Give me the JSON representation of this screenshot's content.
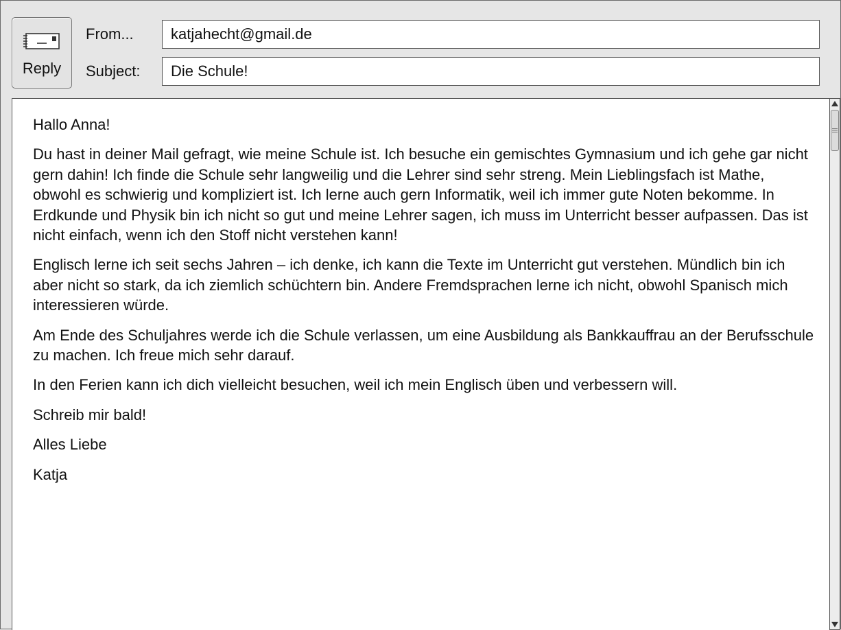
{
  "header": {
    "reply_label": "Reply",
    "from_label": "From...",
    "from_value": "katjahecht@gmail.de",
    "subject_label": "Subject:",
    "subject_value": "Die Schule!",
    "reply_icon": "envelope-icon"
  },
  "message": {
    "paragraphs": [
      "Hallo Anna!",
      "Du hast in deiner Mail gefragt, wie meine Schule ist. Ich besuche ein gemischtes Gymnasium und ich gehe gar nicht gern dahin! Ich finde die Schule sehr langweilig und die Lehrer sind sehr streng. Mein Lieblingsfach ist Mathe, obwohl es schwierig und kompliziert ist. Ich lerne auch gern Informatik, weil ich immer gute Noten bekomme. In Erdkunde und Physik bin ich nicht so gut und meine Lehrer sagen, ich muss im Unterricht besser aufpassen. Das ist nicht einfach, wenn ich den Stoff nicht verstehen kann!",
      "Englisch lerne ich seit sechs Jahren – ich denke, ich kann die Texte im Unterricht gut verstehen. Mündlich bin ich aber nicht so stark, da ich ziemlich schüchtern bin. Andere Fremdsprachen lerne ich nicht, obwohl Spanisch mich interessieren würde.",
      "Am Ende des Schuljahres werde ich die Schule verlassen, um eine Ausbildung als Bankkauffrau an der Berufsschule zu machen. Ich freue mich sehr darauf.",
      "In den Ferien kann ich dich vielleicht besuchen, weil ich mein Englisch üben und verbessern will.",
      "Schreib mir bald!",
      "Alles Liebe",
      "Katja"
    ]
  },
  "scrollbar": {
    "up_icon": "arrow-up-icon",
    "down_icon": "arrow-down-icon",
    "thumb_icon": "grip-icon"
  }
}
